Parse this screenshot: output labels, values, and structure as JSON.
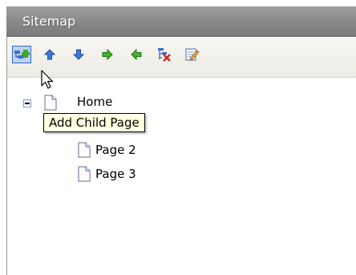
{
  "panel": {
    "title": "Sitemap"
  },
  "toolbar": {
    "buttons": [
      {
        "name": "add-child-page-icon",
        "label": "Add Child Page",
        "hover": true
      },
      {
        "name": "move-up-icon"
      },
      {
        "name": "move-down-icon"
      },
      {
        "name": "indent-right-icon"
      },
      {
        "name": "outdent-left-icon"
      },
      {
        "name": "delete-page-icon"
      },
      {
        "name": "edit-page-icon"
      }
    ]
  },
  "tree": {
    "root": {
      "label": "Home",
      "expanded": true
    },
    "children": [
      {
        "label": "Page 2"
      },
      {
        "label": "Page 3"
      }
    ]
  },
  "tooltip": {
    "text": "Add Child Page"
  },
  "colors": {
    "title_bar": "#8a8a8a",
    "tooltip_bg": "#ffffe1",
    "hover_border": "#316ac5"
  }
}
